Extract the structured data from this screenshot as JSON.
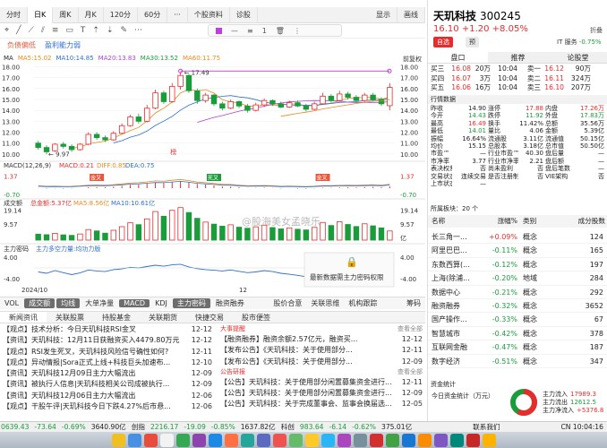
{
  "period_tabs": [
    "分时",
    "日K",
    "周K",
    "月K",
    "120分",
    "60分",
    "···",
    "个股资料",
    "诊股"
  ],
  "period_right": [
    "显示",
    "画线"
  ],
  "active_period": "日K",
  "indicator_titles": [
    "负债偏低",
    "盈利能力弱"
  ],
  "float_tool_value": "1",
  "ma_header": {
    "label": "MA",
    "ma5": "MA5:15.02",
    "ma10": "MA10:14.85",
    "ma20": "MA20:13.83",
    "ma30": "MA30:13.52",
    "ma60": "MA60:11.75",
    "right": "前复权"
  },
  "price_axis": [
    "18.00",
    "17.00",
    "16.00",
    "15.00",
    "14.00",
    "13.00",
    "12.00",
    "11.00",
    "10.00"
  ],
  "price_axis_right": [
    "18.00",
    "17.00",
    "16.00",
    "15.00",
    "14.00",
    "13.00",
    "12.00",
    "11.00",
    "10.00"
  ],
  "high_label": "17.49",
  "low_label": "9.97",
  "marker_label": "榜",
  "macd_header": {
    "label": "MACD(12,26,9)",
    "macd": "MACD:0.21",
    "diff": "DIFF:0.85",
    "dea": "DEA:0.75"
  },
  "macd_axis": [
    "1.37",
    "-0.70"
  ],
  "macd_tags": [
    "金叉",
    "死叉",
    "金叉"
  ],
  "vol_header": {
    "label": "成交额",
    "total": "总金额:5.37亿",
    "ma5": "MA5:8.56亿",
    "ma10": "MA10:10.61亿"
  },
  "vol_axis": [
    "19.14",
    "9.57"
  ],
  "vol_unit": "亿",
  "watermark": "@股海美女孟晓乐",
  "main_header": {
    "label": "主力密码",
    "up": "主力多空力量:均功力版"
  },
  "main_axis": [
    "4.00",
    "-4.00"
  ],
  "main_axis_right": [
    "4.00",
    "-4.00"
  ],
  "main_unlock": "最新数据需主力密码权限",
  "date_labels": [
    "2024/10",
    "12"
  ],
  "bottom_tabs": [
    "VOL",
    "成交额",
    "均线",
    "大单净量",
    "MACD",
    "KDJ",
    "主力密码",
    "融资融券",
    "",
    "股价合意",
    "关联思维",
    "机构跟踪",
    "",
    "筹码"
  ],
  "bottom_tabs_dark": [
    "成交额",
    "均线",
    "MACD",
    "主力密码"
  ],
  "news_tabs": [
    "新闻资讯",
    "关联股票",
    "持股基金",
    "关联期货",
    "快捷交易",
    "股市便签"
  ],
  "news_left": [
    {
      "tag": "【观点】",
      "title": "技术分析：今日天玑科技RSI金叉",
      "date": "12-12"
    },
    {
      "tag": "【资讯】",
      "title": "天玑科技：12月11日获融资买入4479.80万元",
      "date": "12-12"
    },
    {
      "tag": "【观点】",
      "title": "RSI发生死叉，天玑科技风险信号确性如何?",
      "date": "12-11"
    },
    {
      "tag": "【观点】",
      "title": "异动情报|Sora正式上线+科技巨头加速布...",
      "date": "12-10"
    },
    {
      "tag": "【资讯】",
      "title": "天玑科技12月09日主力大幅流出",
      "date": "12-09"
    },
    {
      "tag": "【资讯】",
      "title": "被执行人信息|天玑科技相关公司成被执行...",
      "date": "12-09"
    },
    {
      "tag": "【资讯】",
      "title": "天玑科技12月06日主力大幅流出",
      "date": "12-06"
    },
    {
      "tag": "【观点】",
      "title": "干股午评|天玑科技今日下跌4.27%后市悬...",
      "date": "12-06"
    }
  ],
  "news_right_head1": {
    "title": "大事提醒",
    "more": "查看全部"
  },
  "news_right1": [
    {
      "tag": "【融资融券】",
      "title": "融资余额2.57亿元，融资买...",
      "date": "12-12"
    },
    {
      "tag": "【发布公告】",
      "title": "《天玑科技：关于使用部分...",
      "date": "12-11"
    },
    {
      "tag": "【发布公告】",
      "title": "《天玑科技：关于使用部分...",
      "date": "12-09"
    }
  ],
  "news_right_head2": {
    "title": "公告研报",
    "more": "查看全部"
  },
  "news_right2": [
    {
      "tag": "【公告】",
      "title": "天玑科技：关于使用部分闲置募集资金进行...",
      "date": "12-11"
    },
    {
      "tag": "【公告】",
      "title": "天玑科技：关于使用部分闲置募集资金进行...",
      "date": "12-09"
    },
    {
      "tag": "【公告】",
      "title": "天玑科技：关于完成董事会、监事会换届选...",
      "date": "12-05"
    }
  ],
  "status_bar": [
    {
      "text": "0639.43",
      "cls": "green"
    },
    {
      "text": "-73.64",
      "cls": "green"
    },
    {
      "text": "-0.69%",
      "cls": "green"
    },
    {
      "text": "3640.90亿",
      "cls": ""
    },
    {
      "text": "创指",
      "cls": ""
    },
    {
      "text": "2216.17",
      "cls": "green"
    },
    {
      "text": "-19.09",
      "cls": "green"
    },
    {
      "text": "-0.85%",
      "cls": "green"
    },
    {
      "text": "1637.82亿",
      "cls": ""
    },
    {
      "text": "科创",
      "cls": ""
    },
    {
      "text": "983.64",
      "cls": "green"
    },
    {
      "text": "-6.14",
      "cls": "green"
    },
    {
      "text": "-0.62%",
      "cls": "green"
    },
    {
      "text": "375.01亿",
      "cls": ""
    },
    {
      "text": "联系我们",
      "cls": ""
    },
    {
      "text": "CN 10:04:16",
      "cls": ""
    }
  ],
  "stock": {
    "name": "天玑科技",
    "code": "300245",
    "price": "16.10",
    "change": "+1.20",
    "pct": "+8.05%",
    "btn_self": "自选",
    "btn_warn": "预",
    "it_service": "IT 服务",
    "it_change": "-0.75%",
    "extra": "折叠"
  },
  "right_tabs": [
    "盘口",
    "推荐",
    "论股堂"
  ],
  "order_book": [
    {
      "l": "买三",
      "p": "16.08",
      "v": "20万",
      "t": "10:04",
      "side": "卖一",
      "p2": "16.12",
      "v2": "90万"
    },
    {
      "l": "买四",
      "p": "16.07",
      "v": "3万",
      "t": "10:04",
      "side": "卖二",
      "p2": "16.11",
      "v2": "324万"
    },
    {
      "l": "买五",
      "p": "16.06",
      "v": "16万",
      "t": "10:04",
      "side": "卖三",
      "p2": "16.10",
      "v2": "207万"
    }
  ],
  "stats_title": "行情数据",
  "stats": [
    [
      "昨收",
      "14.90",
      "涨停",
      "17.88",
      "内盘",
      "17.26万"
    ],
    [
      "今开",
      "14.43",
      "跌停",
      "11.92",
      "外盘",
      "17.83万"
    ],
    [
      "最高",
      "16.49",
      "换手",
      "11.42%",
      "总额",
      "35.56万"
    ],
    [
      "最低",
      "14.01",
      "量比",
      "4.06",
      "金额",
      "5.39亿"
    ],
    [
      "振幅",
      "16.64%",
      "流通股",
      "3.11亿",
      "流通值",
      "50.15亿"
    ],
    [
      "均价",
      "15.15",
      "总股本",
      "3.18亿",
      "总市值",
      "50.50亿"
    ],
    [
      "市盈™",
      "—",
      "行业市盈™",
      "40.30",
      "盘后量",
      "—"
    ],
    [
      "市净率",
      "3.77",
      "行业市净率",
      "2.21",
      "盘后额",
      "—"
    ],
    [
      "表决权差异",
      "否",
      "尚未盈利",
      "否",
      "盘后笔数",
      "—"
    ],
    [
      "交易状态",
      "连续交易",
      "是否注册制",
      "否",
      "VIE架构",
      "否"
    ],
    [
      "上市状态",
      "—",
      "",
      "",
      "",
      ""
    ]
  ],
  "sector_title": "所属板块：20 个",
  "sector_head": [
    "名称",
    "涨幅%",
    "类别",
    "成分股数"
  ],
  "sectors": [
    {
      "name": "长三角一...",
      "pct": "+0.09%",
      "type": "概念",
      "count": "124",
      "up": true
    },
    {
      "name": "阿里巴巴...",
      "pct": "-0.11%",
      "type": "概念",
      "count": "165",
      "up": false
    },
    {
      "name": "东数西算(...",
      "pct": "-0.12%",
      "type": "概念",
      "count": "197",
      "up": false
    },
    {
      "name": "上海(除浦...",
      "pct": "-0.20%",
      "type": "地域",
      "count": "284",
      "up": false
    },
    {
      "name": "数据中心",
      "pct": "-0.21%",
      "type": "概念",
      "count": "292",
      "up": false
    },
    {
      "name": "融资融券",
      "pct": "-0.32%",
      "type": "概念",
      "count": "3652",
      "up": false
    },
    {
      "name": "国产操作...",
      "pct": "-0.33%",
      "type": "概念",
      "count": "67",
      "up": false
    },
    {
      "name": "智慧城市",
      "pct": "-0.42%",
      "type": "概念",
      "count": "378",
      "up": false
    },
    {
      "name": "互联网金融",
      "pct": "-0.47%",
      "type": "概念",
      "count": "187",
      "up": false
    },
    {
      "name": "数字经济",
      "pct": "-0.51%",
      "type": "概念",
      "count": "347",
      "up": false
    }
  ],
  "fund_title": "资金统计",
  "fund_label": "今日资金统计（万元）",
  "fund_items": [
    {
      "name": "主力流入",
      "value": "17989.3",
      "cls": "red"
    },
    {
      "name": "主力流出",
      "value": "12612.5",
      "cls": "green"
    },
    {
      "name": "主力净流入",
      "value": "+5376.8",
      "cls": "red"
    }
  ],
  "colors": {
    "up": "#e62d2d",
    "down": "#1a9c3a",
    "ma5": "#e88a1c",
    "ma10": "#2d6fd0",
    "ma20": "#b241d6"
  },
  "chart_data": {
    "type": "candlestick",
    "title": "",
    "price_range": [
      9.5,
      18.2
    ],
    "candles": [
      {
        "o": 11.0,
        "c": 10.6,
        "h": 11.2,
        "l": 10.4
      },
      {
        "o": 10.6,
        "c": 10.2,
        "h": 10.8,
        "l": 9.97
      },
      {
        "o": 10.3,
        "c": 10.9,
        "h": 11.0,
        "l": 10.2
      },
      {
        "o": 10.9,
        "c": 10.7,
        "h": 11.1,
        "l": 10.5
      },
      {
        "o": 10.7,
        "c": 10.4,
        "h": 10.9,
        "l": 10.2
      },
      {
        "o": 10.4,
        "c": 10.9,
        "h": 11.0,
        "l": 10.3
      },
      {
        "o": 10.9,
        "c": 11.8,
        "h": 12.0,
        "l": 10.8
      },
      {
        "o": 11.8,
        "c": 11.5,
        "h": 12.0,
        "l": 11.3
      },
      {
        "o": 11.5,
        "c": 11.3,
        "h": 11.7,
        "l": 11.1
      },
      {
        "o": 11.3,
        "c": 11.9,
        "h": 12.1,
        "l": 11.2
      },
      {
        "o": 11.9,
        "c": 12.6,
        "h": 12.8,
        "l": 11.8
      },
      {
        "o": 12.6,
        "c": 13.4,
        "h": 13.6,
        "l": 12.5
      },
      {
        "o": 13.4,
        "c": 13.0,
        "h": 13.7,
        "l": 12.8
      },
      {
        "o": 13.0,
        "c": 14.2,
        "h": 14.5,
        "l": 12.9
      },
      {
        "o": 14.2,
        "c": 15.6,
        "h": 15.9,
        "l": 14.1
      },
      {
        "o": 15.6,
        "c": 14.8,
        "h": 15.8,
        "l": 14.6
      },
      {
        "o": 14.8,
        "c": 16.2,
        "h": 16.5,
        "l": 14.7
      },
      {
        "o": 16.2,
        "c": 17.2,
        "h": 17.49,
        "l": 15.9
      },
      {
        "o": 17.2,
        "c": 15.8,
        "h": 17.3,
        "l": 15.6
      },
      {
        "o": 15.8,
        "c": 14.9,
        "h": 16.0,
        "l": 14.6
      },
      {
        "o": 14.9,
        "c": 15.4,
        "h": 15.6,
        "l": 14.7
      },
      {
        "o": 15.4,
        "c": 14.6,
        "h": 15.5,
        "l": 14.4
      },
      {
        "o": 14.6,
        "c": 14.2,
        "h": 14.8,
        "l": 14.0
      },
      {
        "o": 14.2,
        "c": 14.8,
        "h": 15.0,
        "l": 14.1
      },
      {
        "o": 14.8,
        "c": 14.4,
        "h": 14.9,
        "l": 14.2
      },
      {
        "o": 14.4,
        "c": 14.0,
        "h": 14.6,
        "l": 13.8
      },
      {
        "o": 14.0,
        "c": 14.5,
        "h": 14.7,
        "l": 13.9
      },
      {
        "o": 14.5,
        "c": 14.9,
        "h": 15.1,
        "l": 14.3
      },
      {
        "o": 14.9,
        "c": 14.6,
        "h": 15.0,
        "l": 14.4
      },
      {
        "o": 14.6,
        "c": 14.3,
        "h": 14.8,
        "l": 14.2
      },
      {
        "o": 14.3,
        "c": 14.7,
        "h": 14.9,
        "l": 14.2
      },
      {
        "o": 14.7,
        "c": 14.4,
        "h": 14.9,
        "l": 14.3
      },
      {
        "o": 14.4,
        "c": 14.1,
        "h": 14.6,
        "l": 13.9
      },
      {
        "o": 14.1,
        "c": 14.6,
        "h": 14.8,
        "l": 14.0
      },
      {
        "o": 14.6,
        "c": 15.3,
        "h": 15.6,
        "l": 14.5
      },
      {
        "o": 15.3,
        "c": 14.9,
        "h": 15.5,
        "l": 14.7
      },
      {
        "o": 14.9,
        "c": 15.5,
        "h": 15.8,
        "l": 14.8
      },
      {
        "o": 15.5,
        "c": 15.2,
        "h": 15.7,
        "l": 15.0
      },
      {
        "o": 15.2,
        "c": 14.9,
        "h": 15.4,
        "l": 14.7
      },
      {
        "o": 14.9,
        "c": 15.4,
        "h": 15.6,
        "l": 14.8
      },
      {
        "o": 15.4,
        "c": 15.0,
        "h": 15.6,
        "l": 14.8
      },
      {
        "o": 15.0,
        "c": 14.6,
        "h": 15.2,
        "l": 14.4
      },
      {
        "o": 14.43,
        "c": 16.1,
        "h": 16.49,
        "l": 14.01
      }
    ],
    "ma5_range_note": "",
    "macd_range": [
      -1.0,
      1.6
    ],
    "macd": [
      0.02,
      -0.05,
      -0.03,
      -0.06,
      -0.04,
      0.01,
      0.1,
      0.12,
      0.1,
      0.16,
      0.24,
      0.36,
      0.4,
      0.5,
      0.62,
      0.58,
      0.7,
      0.8,
      0.66,
      0.48,
      0.4,
      0.3,
      0.2,
      0.18,
      0.1,
      0.02,
      0.04,
      0.06,
      0.02,
      -0.04,
      -0.02,
      -0.05,
      -0.08,
      -0.03,
      0.05,
      0.04,
      0.08,
      0.1,
      0.08,
      0.12,
      0.14,
      0.1,
      0.21
    ],
    "volume_range": [
      0,
      20
    ],
    "volume": [
      3.5,
      3.2,
      4.0,
      3.1,
      2.8,
      3.6,
      6.2,
      5.4,
      4.1,
      5.8,
      7.9,
      10.2,
      9.1,
      12.5,
      16.8,
      14.0,
      17.5,
      19.1,
      16.2,
      12.8,
      10.6,
      9.4,
      8.2,
      9.0,
      7.6,
      7.0,
      7.8,
      8.8,
      7.4,
      6.6,
      7.2,
      6.4,
      6.0,
      7.5,
      10.4,
      8.6,
      10.8,
      9.2,
      8.0,
      9.6,
      8.4,
      7.2,
      5.37
    ],
    "main_range": [
      -4,
      4
    ],
    "main": [
      -1.2,
      -1.6,
      -0.8,
      -1.4,
      -2.0,
      -1.5,
      -0.6,
      -0.9,
      -1.1,
      -0.5,
      -0.3,
      0.2,
      0.0,
      0.4,
      0.8,
      0.5,
      0.9,
      1.1,
      0.3,
      -0.2,
      -0.5,
      -0.7,
      -0.9,
      -0.6,
      -1.0,
      -1.4,
      -1.2,
      -0.8,
      -1.1,
      -1.6,
      -1.9,
      -2.2,
      -2.6,
      -3.0,
      -2.0,
      -1.6
    ],
    "xlabels": [
      "2024/10",
      "12"
    ]
  }
}
